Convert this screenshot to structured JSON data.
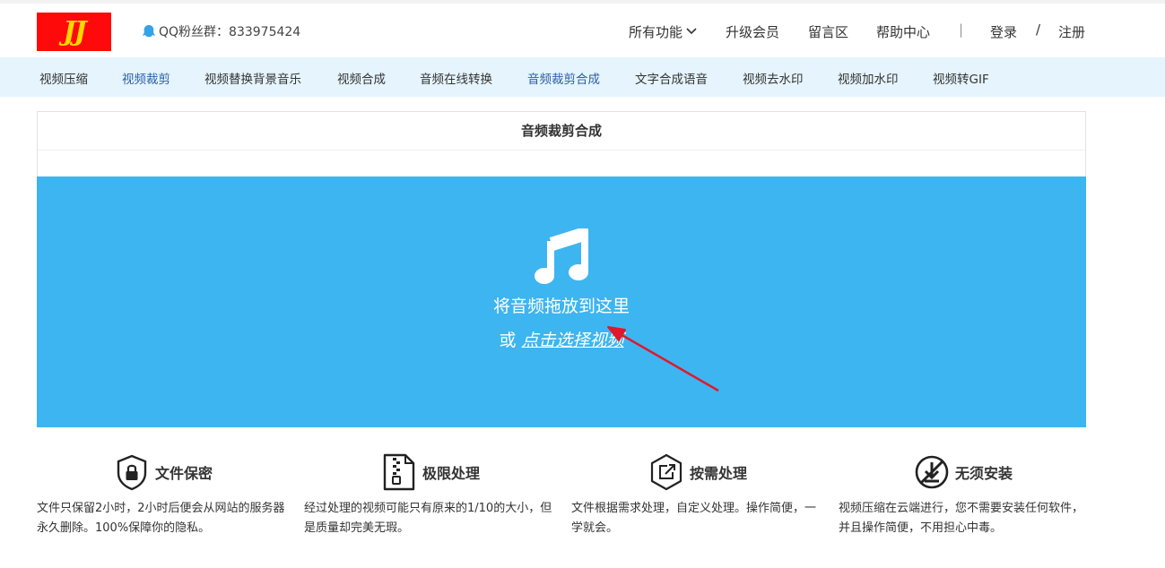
{
  "header": {
    "logo_text": "JJ",
    "qq_text": "QQ粉丝群：833975424",
    "nav": {
      "all_features": "所有功能",
      "upgrade": "升级会员",
      "message_board": "留言区",
      "help": "帮助中心",
      "divider": "|",
      "login": "登录",
      "slash": "/",
      "register": "注册"
    }
  },
  "subnav": {
    "items": [
      {
        "label": "视频压缩"
      },
      {
        "label": "视频裁剪"
      },
      {
        "label": "视频替换背景音乐"
      },
      {
        "label": "视频合成"
      },
      {
        "label": "音频在线转换"
      },
      {
        "label": "音频裁剪合成"
      },
      {
        "label": "文字合成语音"
      },
      {
        "label": "视频去水印"
      },
      {
        "label": "视频加水印"
      },
      {
        "label": "视频转GIF"
      }
    ]
  },
  "panel": {
    "title": "音频裁剪合成"
  },
  "dropzone": {
    "icon": "music-note-icon",
    "text": "将音频拖放到这里",
    "or": "或",
    "link": "点击选择视频"
  },
  "features": [
    {
      "icon": "shield-lock-icon",
      "title": "文件保密",
      "desc": "文件只保留2小时，2小时后便会从网站的服务器永久删除。100%保障你的隐私。"
    },
    {
      "icon": "zip-file-icon",
      "title": "极限处理",
      "desc": "经过处理的视频可能只有原来的1/10的大小，但是质量却完美无瑕。"
    },
    {
      "icon": "hexagon-share-icon",
      "title": "按需处理",
      "desc": "文件根据需求处理，自定义处理。操作简便，一学就会。"
    },
    {
      "icon": "no-install-icon",
      "title": "无须安装",
      "desc": "视频压缩在云端进行，您不需要安装任何软件，并且操作简便，不用担心中毒。"
    }
  ],
  "colors": {
    "logo_bg": "#ff0a0a",
    "logo_text": "#ffd800",
    "subnav_bg": "#e5f4fd",
    "subnav_active": "#2b5ea8",
    "dropzone_bg": "#3db5f0",
    "annotation_arrow": "#e0182a"
  }
}
